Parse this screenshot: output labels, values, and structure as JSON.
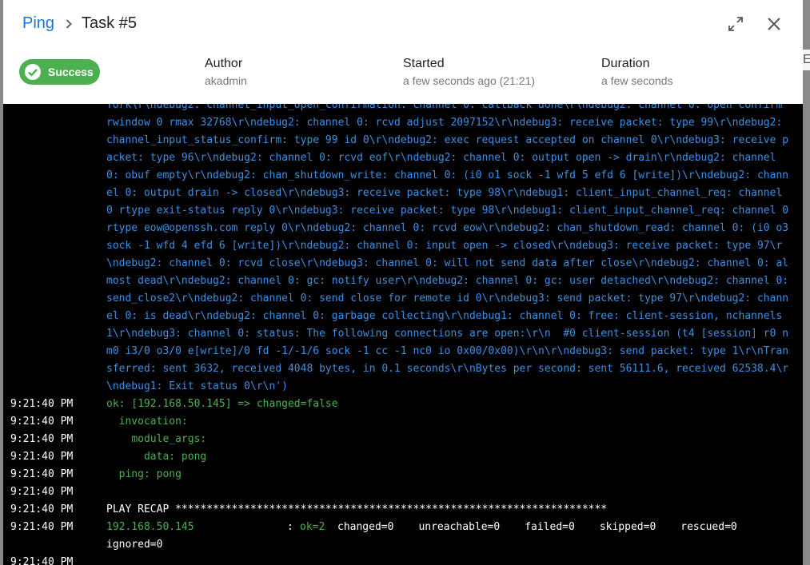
{
  "backdrop": {
    "edge_text": "E"
  },
  "header": {
    "project": "Ping",
    "task": "Task #5",
    "status": "Success",
    "author_label": "Author",
    "author_value": "akadmin",
    "started_label": "Started",
    "started_value": "a few seconds ago (21:21)",
    "duration_label": "Duration",
    "duration_value": "a few seconds",
    "icons": {
      "expand": "fullscreen-icon",
      "close": "close-icon",
      "status": "check-circle-icon",
      "breadcrumb": "chevron-right-icon"
    }
  },
  "colors": {
    "accent": "#1976d2",
    "success": "#4caf50",
    "log_blue": "#3d8fe0",
    "log_bg": "#000000"
  },
  "log": {
    "blue_block": "York\\r\\ndebug2: channel_input_open_confirmation: channel 0: callback done\\r\\ndebug2: channel 0: open confirm rwindow 0 rmax 32768\\r\\ndebug2: channel 0: rcvd adjust 2097152\\r\\ndebug3: receive packet: type 99\\r\\ndebug2: channel_input_status_confirm: type 99 id 0\\r\\ndebug2: exec request accepted on channel 0\\r\\ndebug3: receive packet: type 96\\r\\ndebug2: channel 0: rcvd eof\\r\\ndebug2: channel 0: output open -> drain\\r\\ndebug2: channel 0: obuf empty\\r\\ndebug2: chan_shutdown_write: channel 0: (i0 o1 sock -1 wfd 5 efd 6 [write])\\r\\ndebug2: channel 0: output drain -> closed\\r\\ndebug3: receive packet: type 98\\r\\ndebug1: client_input_channel_req: channel 0 rtype exit-status reply 0\\r\\ndebug3: receive packet: type 98\\r\\ndebug1: client_input_channel_req: channel 0 rtype eow@openssh.com reply 0\\r\\ndebug2: channel 0: rcvd eow\\r\\ndebug2: chan_shutdown_read: channel 0: (i0 o3 sock -1 wfd 4 efd 6 [write])\\r\\ndebug2: channel 0: input open -> closed\\r\\ndebug3: receive packet: type 97\\r\\ndebug2: channel 0: rcvd close\\r\\ndebug3: channel 0: will not send data after close\\r\\ndebug2: channel 0: almost dead\\r\\ndebug2: channel 0: gc: notify user\\r\\ndebug2: channel 0: gc: user detached\\r\\ndebug2: channel 0: send_close2\\r\\ndebug2: channel 0: send close for remote id 0\\r\\ndebug3: send packet: type 97\\r\\ndebug2: channel 0: is dead\\r\\ndebug2: channel 0: garbage collecting\\r\\ndebug1: channel 0: free: client-session, nchannels 1\\r\\ndebug3: channel 0: status: The following connections are open:\\r\\n  #0 client-session (t4 [session] r0 nm0 i3/0 o3/0 e[write]/0 fd -1/-1/6 sock -1 cc -1 nc0 io 0x00/0x00)\\r\\n\\r\\ndebug3: send packet: type 1\\r\\nTransferred: sent 3632, received 4048 bytes, in 0.1 seconds\\r\\nBytes per second: sent 56111.6, received 62538.4\\r\\ndebug1: Exit status 0\\r\\n')",
    "lines": [
      {
        "time": "9:21:40 PM",
        "text": "ok: [192.168.50.145] => changed=false",
        "color": "green"
      },
      {
        "time": "9:21:40 PM",
        "text": "  invocation:",
        "color": "green"
      },
      {
        "time": "9:21:40 PM",
        "text": "    module_args:",
        "color": "green"
      },
      {
        "time": "9:21:40 PM",
        "text": "      data: pong",
        "color": "green"
      },
      {
        "time": "9:21:40 PM",
        "text": "  ping: pong",
        "color": "green"
      },
      {
        "time": "9:21:40 PM",
        "text": "",
        "color": "white"
      },
      {
        "time": "9:21:40 PM",
        "text": "PLAY RECAP *********************************************************************",
        "color": "white"
      }
    ],
    "recap": {
      "time": "9:21:40 PM",
      "host": "192.168.50.145",
      "colon": ":",
      "ok": "ok=2",
      "changed": "changed=0",
      "unreachable": "unreachable=0",
      "failed": "failed=0",
      "skipped": "skipped=0",
      "rescued": "rescued=0",
      "ignored": "ignored=0"
    },
    "last_time": "9:21:40 PM"
  }
}
